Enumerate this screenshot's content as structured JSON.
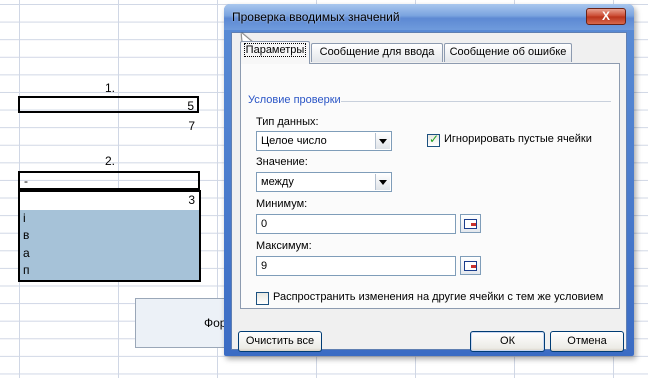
{
  "sheet": {
    "label1": "1.",
    "cell_box": "5",
    "cell_7": "7",
    "label2": "2.",
    "cell_dash": "-",
    "list_items": [
      "3",
      "i",
      "в",
      "а",
      "п"
    ],
    "form_button_text": "Фор"
  },
  "dialog": {
    "title": "Проверка вводимых значений",
    "close_label": "X",
    "tabs": [
      "Параметры",
      "Сообщение для ввода",
      "Сообщение об ошибке"
    ],
    "group_title": "Условие проверки",
    "data_type_label": "Тип данных:",
    "data_type_value": "Целое число",
    "ignore_blank_label": "Игнорировать пустые ячейки",
    "ignore_blank_checked": true,
    "value_label": "Значение:",
    "value_value": "между",
    "min_label": "Минимум:",
    "min_value": "0",
    "max_label": "Максимум:",
    "max_value": "9",
    "apply_label": "Распространить изменения на другие ячейки с тем же условием",
    "apply_checked": false,
    "clear_all_label": "Очистить все",
    "ok_label": "ОК",
    "cancel_label": "Отмена"
  },
  "colors": {
    "titlebar": "#6f9bdc",
    "group_label": "#2a55c6",
    "list_selection": "#a6c2d8",
    "gridlines": "#d0d7e5"
  }
}
